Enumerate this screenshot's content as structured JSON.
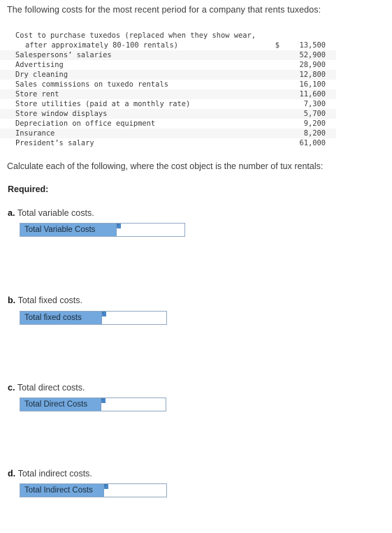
{
  "intro": {
    "text": "The following costs for the most recent period for a company that rents tuxedos:"
  },
  "cost_table": {
    "currency_symbol": "$",
    "rows": [
      {
        "label": "Cost to purchase tuxedos (replaced when they show wear,",
        "currency": "",
        "value": ""
      },
      {
        "label": "after approximately 80-100 rentals)",
        "currency": "$",
        "value": "13,500"
      },
      {
        "label": "Salespersons’ salaries",
        "currency": "",
        "value": "52,900"
      },
      {
        "label": "Advertising",
        "currency": "",
        "value": "28,900"
      },
      {
        "label": "Dry cleaning",
        "currency": "",
        "value": "12,800"
      },
      {
        "label": "Sales commissions on tuxedo rentals",
        "currency": "",
        "value": "16,100"
      },
      {
        "label": "Store rent",
        "currency": "",
        "value": "11,600"
      },
      {
        "label": "Store utilities (paid at a monthly rate)",
        "currency": "",
        "value": "7,300"
      },
      {
        "label": "Store window displays",
        "currency": "",
        "value": "5,700"
      },
      {
        "label": "Depreciation on office equipment",
        "currency": "",
        "value": "9,200"
      },
      {
        "label": "Insurance",
        "currency": "",
        "value": "8,200"
      },
      {
        "label": "President’s salary",
        "currency": "",
        "value": "61,000"
      }
    ]
  },
  "calculate_line": {
    "text": "Calculate each of the following, where the cost object is the number of tux rentals:"
  },
  "required": {
    "heading": "Required:"
  },
  "questions": [
    {
      "marker": "a.",
      "prompt": "Total variable costs.",
      "widget_label": "Total Variable Costs",
      "value": "",
      "placeholder": ""
    },
    {
      "marker": "b.",
      "prompt": "Total fixed costs.",
      "widget_label": "Total fixed costs",
      "value": "",
      "placeholder": ""
    },
    {
      "marker": "c.",
      "prompt": "Total direct costs.",
      "widget_label": "Total Direct Costs",
      "value": "",
      "placeholder": ""
    },
    {
      "marker": "d.",
      "prompt": "Total indirect costs.",
      "widget_label": "Total Indirect Costs",
      "value": "",
      "placeholder": ""
    }
  ],
  "colors": {
    "widget_label_bg": "#72a8de",
    "widget_border": "#8fa8c2",
    "notch": "#4a87c8",
    "table_stripe": "#f6f6f6",
    "body_text": "#3c3c3c"
  }
}
